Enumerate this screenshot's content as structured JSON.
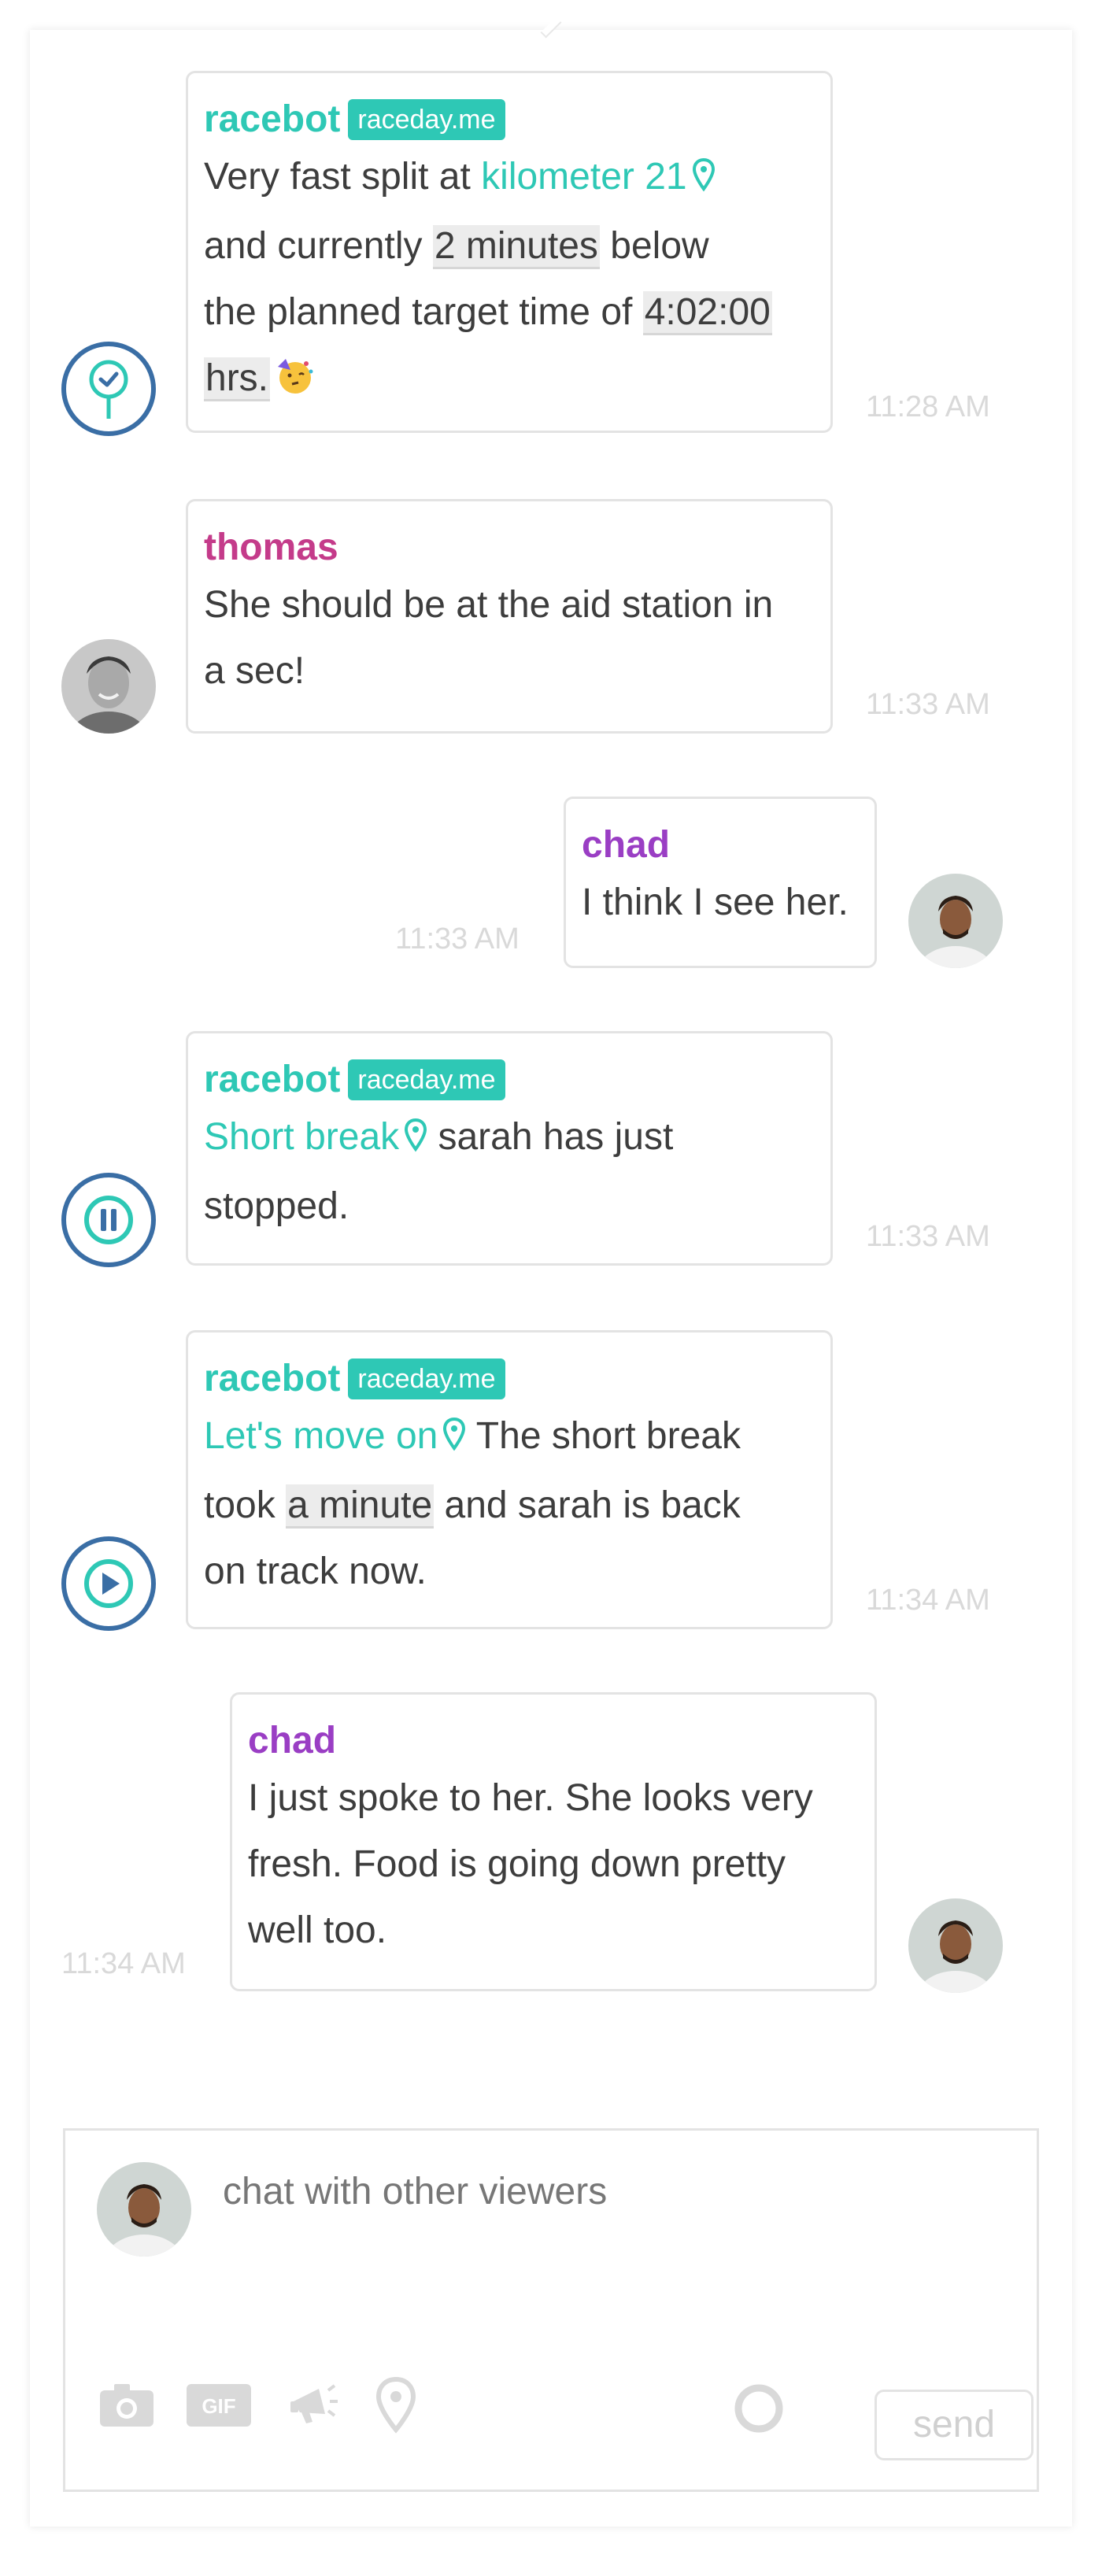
{
  "messages": [
    {
      "sender": "racebot",
      "badge": "raceday.me",
      "segments": {
        "p1": "Very fast split at ",
        "link": "kilometer 21",
        "p2": "and currently ",
        "u1": "2 minutes",
        "p3": " below",
        "p4": "the planned target time of ",
        "u2": "4:02:00",
        "u3": "hrs.",
        "p5": " "
      },
      "time": "11:28 AM",
      "icon": "checkpoint-pin-icon"
    },
    {
      "sender": "thomas",
      "text_line1": "She should be at the aid station in",
      "text_line2": "a sec!",
      "time": "11:33 AM"
    },
    {
      "sender": "chad",
      "text": "I think I see her.",
      "time": "11:33 AM"
    },
    {
      "sender": "racebot",
      "badge": "raceday.me",
      "link": "Short break",
      "text_after": " sarah has just",
      "text_line2": "stopped.",
      "time": "11:33 AM",
      "icon": "pause-icon"
    },
    {
      "sender": "racebot",
      "badge": "raceday.me",
      "link": "Let's move on",
      "text_after": " The short break",
      "p2": "took ",
      "u1": "a minute",
      "p3": " and sarah is back",
      "text_line3": "on track now.",
      "time": "11:34 AM",
      "icon": "play-icon"
    },
    {
      "sender": "chad",
      "text_line1": "I just spoke to her. She looks very",
      "text_line2": "fresh. Food is going down pretty",
      "text_line3": "well too.",
      "time": "11:34 AM"
    }
  ],
  "composer": {
    "placeholder": "chat with other viewers",
    "send_label": "send",
    "tools": [
      "camera-icon",
      "gif-icon",
      "megaphone-icon",
      "location-pin-icon",
      "record-icon"
    ],
    "gif_label": "GIF"
  },
  "colors": {
    "accent": "#2ec8b5",
    "thomas": "#c43b8a",
    "chad": "#9a3ec4",
    "bot_ring": "#3a6ea5"
  }
}
